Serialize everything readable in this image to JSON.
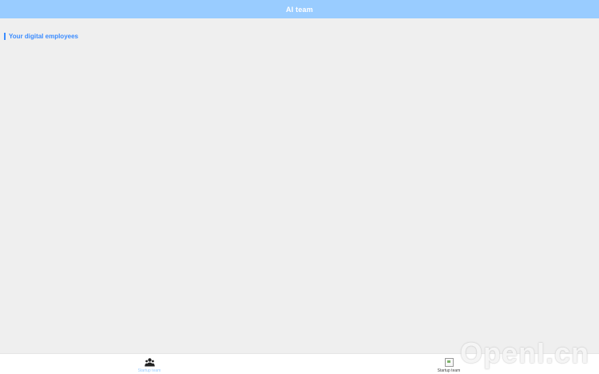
{
  "header": {
    "title": "AI team"
  },
  "section": {
    "title": "Your digital employees"
  },
  "tabs": [
    {
      "label": "Startup team",
      "icon": "team-icon",
      "active": true
    },
    {
      "label": "Startup team",
      "icon": "broken-image-icon",
      "active": false
    }
  ],
  "watermark": {
    "text": "OpenI.cn"
  },
  "colors": {
    "header_bg": "#99ccff",
    "accent": "#3b8cff",
    "background": "#efefef"
  }
}
